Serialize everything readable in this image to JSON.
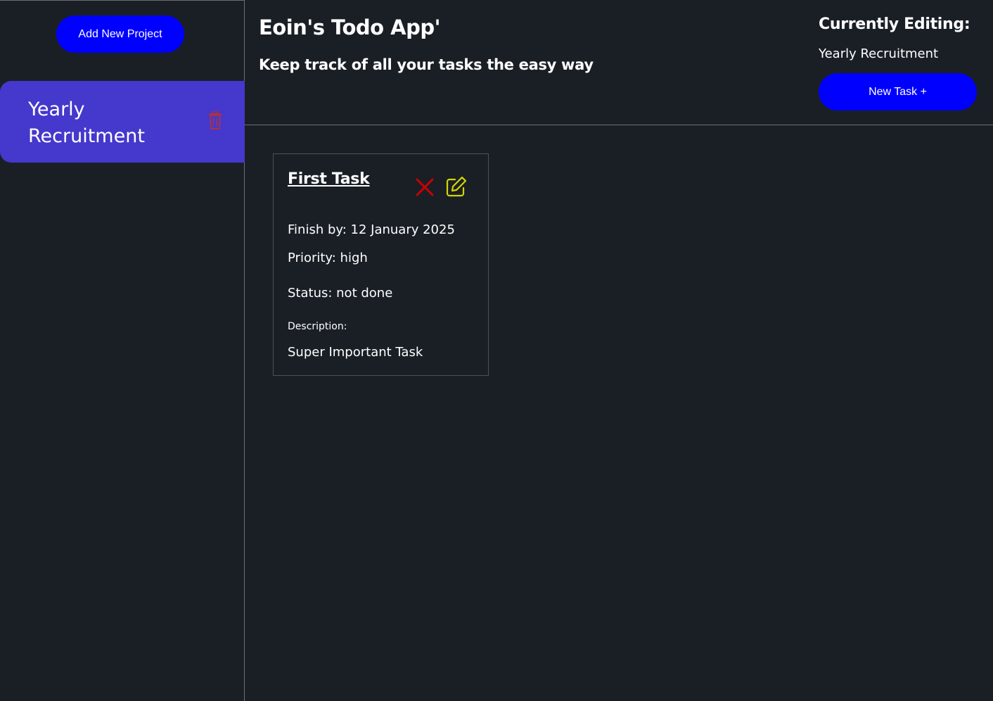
{
  "sidebar": {
    "add_project_label": "Add New Project",
    "projects": [
      {
        "name": "Yearly Recruitment",
        "selected": true
      }
    ]
  },
  "header": {
    "title": "Eoin's Todo App'",
    "subtitle": "Keep track of all your tasks the easy way",
    "editing_label": "Currently Editing:",
    "editing_value": "Yearly Recruitment",
    "new_task_label": "New Task +"
  },
  "tasks": [
    {
      "title": "First Task",
      "finish_by": "Finish by: 12 January 2025",
      "priority": "Priority: high",
      "status": "Status: not done",
      "description_label": "Description:",
      "description": "Super Important Task"
    }
  ],
  "colors": {
    "background": "#1a1f26",
    "accent_blue": "#0000ff",
    "project_selected": "#4538cc",
    "delete_red": "#cc0000",
    "edit_yellow": "#d4d400"
  },
  "icons": {
    "trash": "trash-icon",
    "delete": "close-icon",
    "edit": "edit-icon"
  }
}
